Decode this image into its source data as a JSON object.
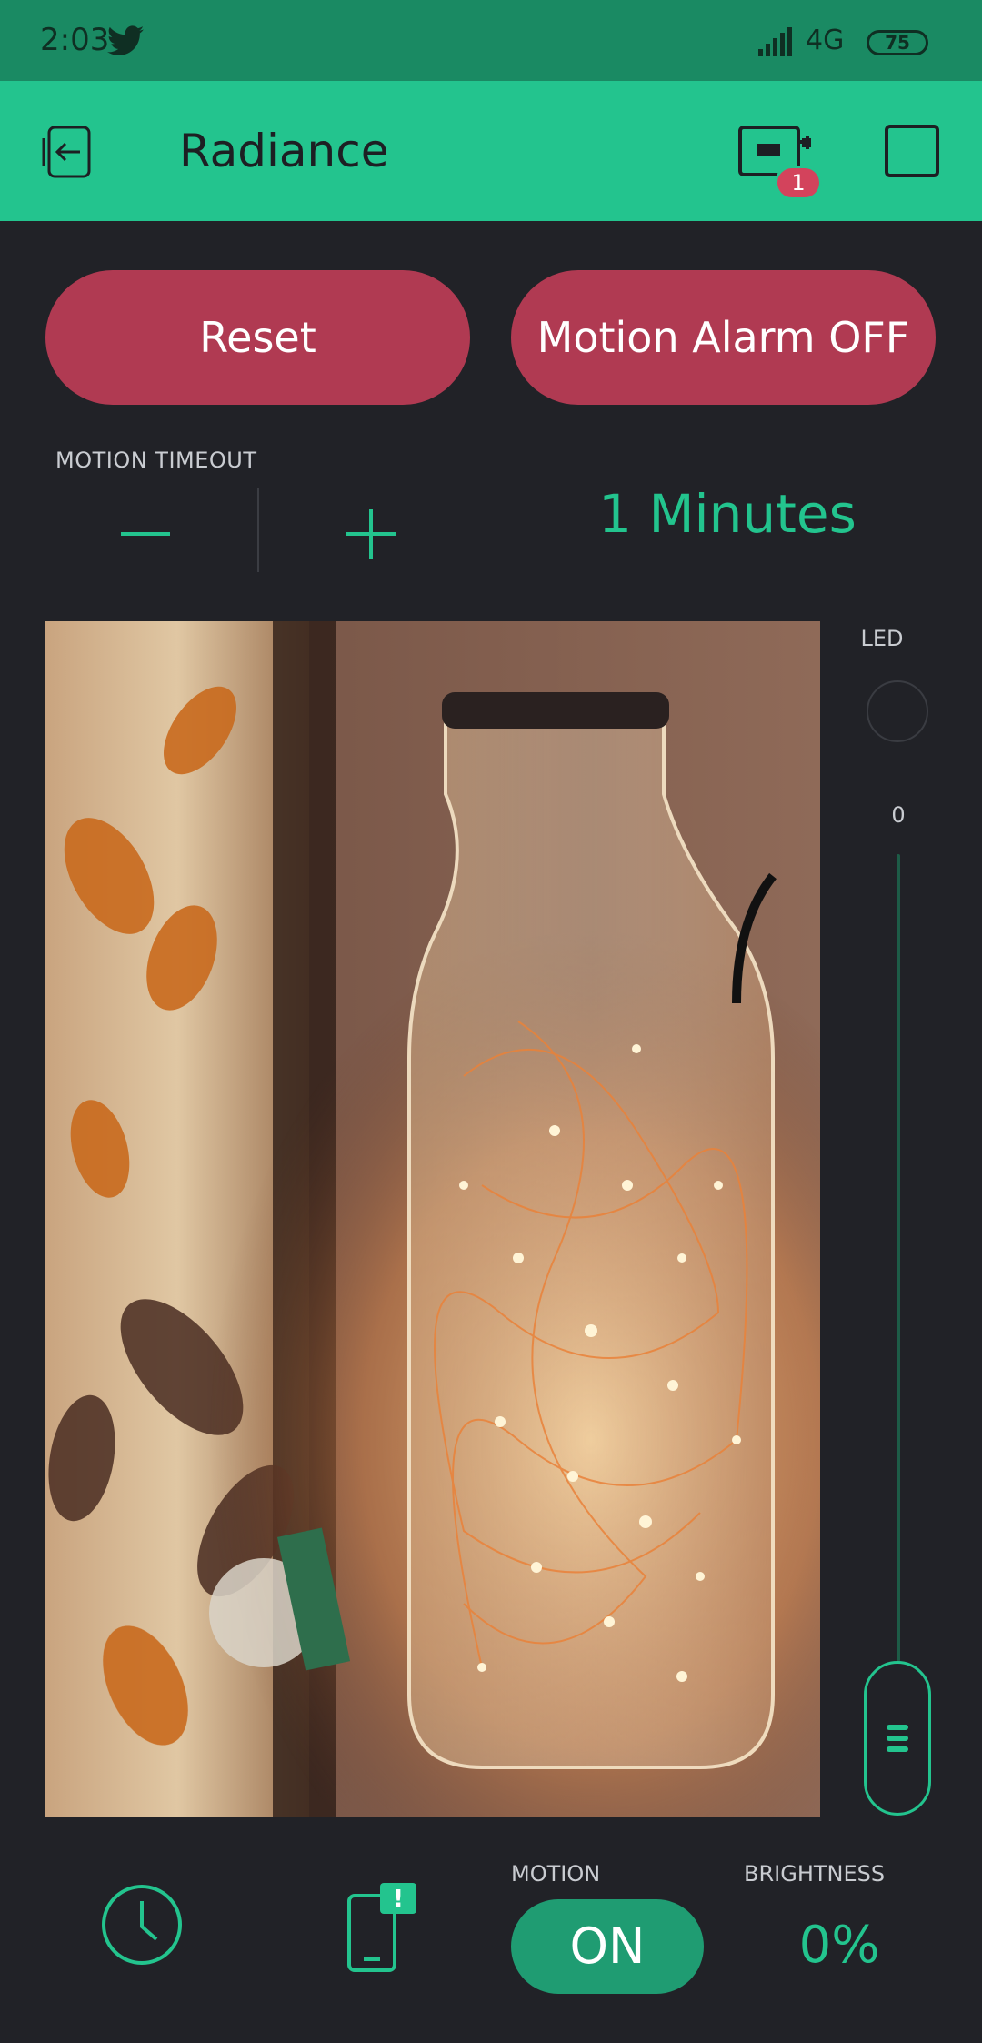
{
  "status_bar": {
    "time": "2:03",
    "network": "4G",
    "battery": "75"
  },
  "app_bar": {
    "title": "Radiance",
    "device_badge_count": "1"
  },
  "buttons": {
    "reset": "Reset",
    "motion_alarm": "Motion Alarm OFF"
  },
  "motion_timeout": {
    "label": "MOTION TIMEOUT",
    "value": "1 Minutes"
  },
  "led": {
    "label": "LED"
  },
  "slider": {
    "value": "0",
    "level": 0
  },
  "motion": {
    "label": "MOTION",
    "state": "ON"
  },
  "brightness": {
    "label": "BRIGHTNESS",
    "value": "0%"
  },
  "colors": {
    "accent": "#23c48e",
    "status_bar": "#1a8a63",
    "button_red": "#b03a52",
    "background": "#212227",
    "badge": "#d3435c"
  },
  "icons": [
    "twitter-icon",
    "signal-icon",
    "back-icon",
    "device-icon",
    "clock-icon",
    "notification-icon",
    "grip-icon"
  ]
}
